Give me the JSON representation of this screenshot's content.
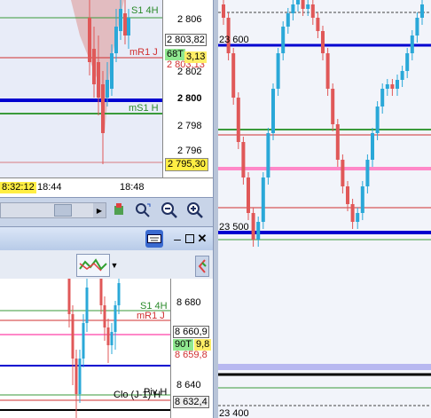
{
  "top_left_chart": {
    "price_ticks": [
      "2 806",
      "2 802",
      "2 800",
      "2 798",
      "2 796"
    ],
    "price_box": "2 803,82",
    "ticks_badge": "68T",
    "spread_value": "3,13",
    "overlap_price": "2 803,13",
    "bottom_price": "2 795,30",
    "time_labels": [
      "8:32:12",
      "18:44",
      "18:48"
    ],
    "line_labels": {
      "s1_4h": "S1 4H",
      "mr1": "mR1 J",
      "ms1": "mS1 H"
    }
  },
  "right_chart": {
    "price_ticks": [
      "23 600",
      "23 500",
      "23 400"
    ]
  },
  "bottom_left_chart": {
    "price_ticks": [
      "8 680",
      "8 640"
    ],
    "price_box": "8 660,9",
    "ticks_badge": "90T",
    "spread_value": "9,8",
    "overlap_price": "8 659,8",
    "bottom_price": "8 632,4",
    "line_labels": {
      "s1_4h": "S1 4H",
      "mr1": "mR1 J",
      "clo": "Clo (J-1) H",
      "piv": "Piv H"
    }
  },
  "toolbar": {
    "icons": [
      "scroll-left-icon",
      "scroll-track",
      "scroll-right-icon",
      "hand-tool-icon",
      "zoom-fit-icon",
      "zoom-out-icon",
      "zoom-in-icon"
    ]
  },
  "window": {
    "controls": [
      "keyboard-icon",
      "minimize-icon",
      "maximize-icon",
      "close-icon"
    ]
  },
  "colors": {
    "chart_bg": "#e8ecf8",
    "bull": "#2aa8d8",
    "bear": "#e05858",
    "blue_line": "#0000d0",
    "green_line": "#3a9a3a",
    "red_line": "#d03030",
    "pink_line": "#ff88c8",
    "toolbar_bg": "#c8d4e8"
  }
}
